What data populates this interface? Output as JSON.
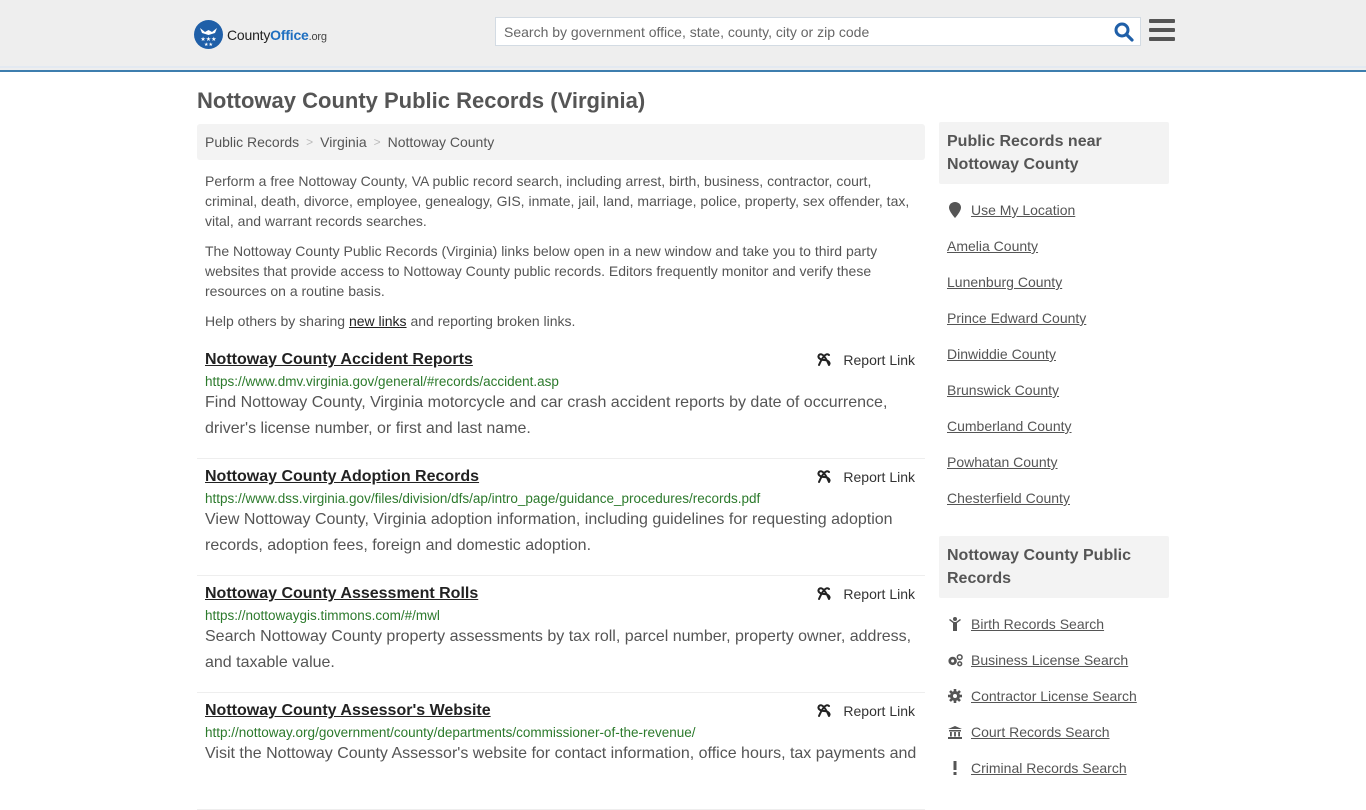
{
  "header": {
    "logo": {
      "brand_part1": "County",
      "brand_part2": "Office",
      "brand_suffix": ".org"
    },
    "search": {
      "placeholder": "Search by government office, state, county, city or zip code",
      "value": ""
    },
    "search_icon": "search-icon",
    "menu_icon": "hamburger-menu-icon"
  },
  "page": {
    "title": "Nottoway County Public Records (Virginia)",
    "breadcrumb": [
      {
        "label": "Public Records"
      },
      {
        "label": "Virginia"
      },
      {
        "label": "Nottoway County"
      }
    ],
    "breadcrumb_separator": ">",
    "intro": {
      "p1": "Perform a free Nottoway County, VA public record search, including arrest, birth, business, contractor, court, criminal, death, divorce, employee, genealogy, GIS, inmate, jail, land, marriage, police, property, sex offender, tax, vital, and warrant records searches.",
      "p2": "The Nottoway County Public Records (Virginia) links below open in a new window and take you to third party websites that provide access to Nottoway County public records. Editors frequently monitor and verify these resources on a routine basis.",
      "p3_before": "Help others by sharing ",
      "p3_link": "new links",
      "p3_after": " and reporting broken links."
    }
  },
  "records": [
    {
      "title": "Nottoway County Accident Reports",
      "url": "https://www.dmv.virginia.gov/general/#records/accident.asp",
      "description": "Find Nottoway County, Virginia motorcycle and car crash accident reports by date of occurrence, driver's license number, or first and last name.",
      "report_label": "Report Link"
    },
    {
      "title": "Nottoway County Adoption Records",
      "url": "https://www.dss.virginia.gov/files/division/dfs/ap/intro_page/guidance_procedures/records.pdf",
      "description": "View Nottoway County, Virginia adoption information, including guidelines for requesting adoption records, adoption fees, foreign and domestic adoption.",
      "report_label": "Report Link"
    },
    {
      "title": "Nottoway County Assessment Rolls",
      "url": "https://nottowaygis.timmons.com/#/mwl",
      "description": "Search Nottoway County property assessments by tax roll, parcel number, property owner, address, and taxable value.",
      "report_label": "Report Link"
    },
    {
      "title": "Nottoway County Assessor's Website",
      "url": "http://nottoway.org/government/county/departments/commissioner-of-the-revenue/",
      "description": "Visit the Nottoway County Assessor's website for contact information, office hours, tax payments and",
      "report_label": "Report Link"
    }
  ],
  "sidebar": {
    "nearby": {
      "heading": "Public Records near Nottoway County",
      "use_location": "Use My Location",
      "counties": [
        "Amelia County",
        "Lunenburg County",
        "Prince Edward County",
        "Dinwiddie County",
        "Brunswick County",
        "Cumberland County",
        "Powhatan County",
        "Chesterfield County"
      ]
    },
    "county_records": {
      "heading": "Nottoway County Public Records",
      "items": [
        {
          "label": "Birth Records Search",
          "icon": "child-icon"
        },
        {
          "label": "Business License Search",
          "icon": "gears-icon"
        },
        {
          "label": "Contractor License Search",
          "icon": "gear-icon"
        },
        {
          "label": "Court Records Search",
          "icon": "courthouse-icon"
        },
        {
          "label": "Criminal Records Search",
          "icon": "exclamation-icon"
        }
      ]
    }
  },
  "colors": {
    "header_bg": "#eeeeee",
    "header_border": "#3d7eae",
    "brand_blue": "#1f5fa8",
    "url_green": "#2c7a2c",
    "text_gray": "#555555"
  }
}
